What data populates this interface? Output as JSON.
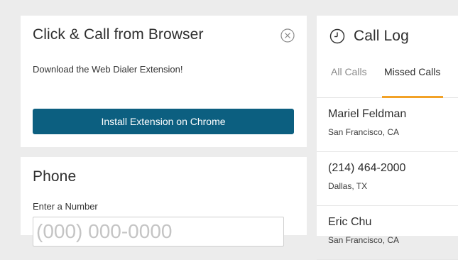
{
  "click_call": {
    "title": "Click & Call from Browser",
    "description": "Download the Web Dialer Extension!",
    "install_label": "Install Extension on Chrome"
  },
  "phone": {
    "title": "Phone",
    "field_label": "Enter a Number",
    "placeholder": "(000) 000-0000"
  },
  "call_log": {
    "title": "Call Log",
    "tabs": [
      {
        "label": "All Calls",
        "active": false
      },
      {
        "label": "Missed Calls",
        "active": true
      }
    ],
    "entries": [
      {
        "name": "Mariel Feldman",
        "location": "San Francisco, CA"
      },
      {
        "name": "(214) 464-2000",
        "location": "Dallas, TX"
      },
      {
        "name": "Eric Chu",
        "location": "San Francisco, CA"
      }
    ]
  },
  "colors": {
    "accent": "#0c5f80",
    "tab_underline": "#f2a227",
    "background": "#ececec"
  }
}
